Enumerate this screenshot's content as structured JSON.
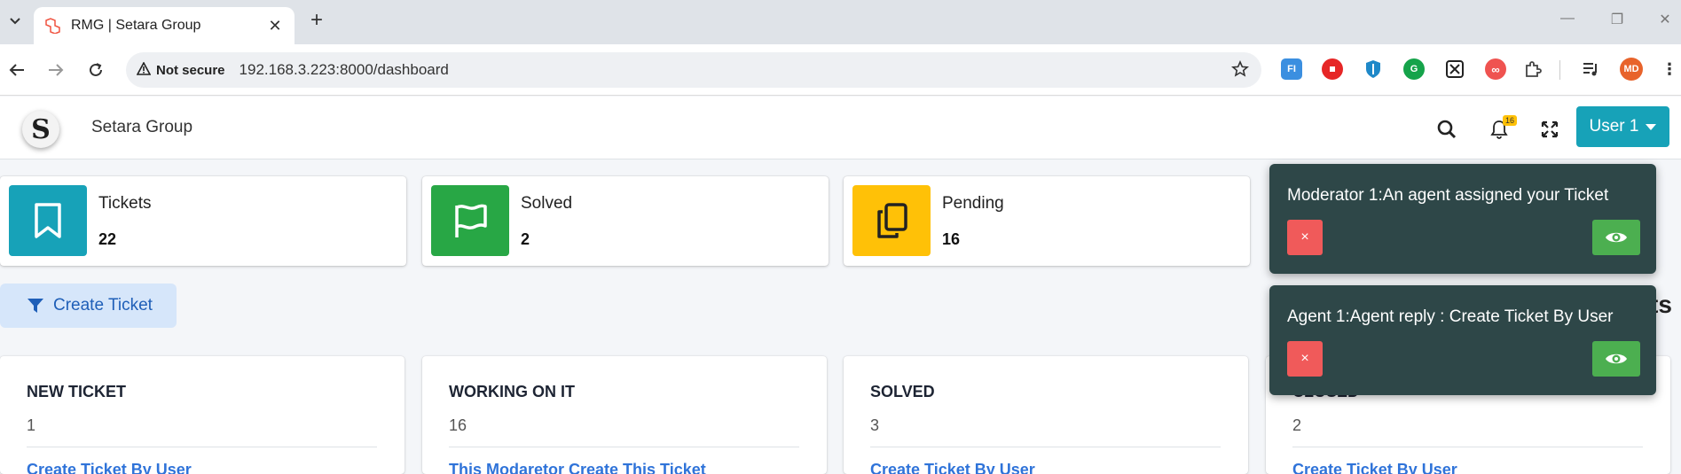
{
  "browser": {
    "tab_title": "RMG | Setara Group",
    "not_secure_label": "Not secure",
    "url": "192.168.3.223:8000/dashboard",
    "extensions": [
      {
        "name": "FI",
        "color": "#3b8fe0"
      },
      {
        "name": "",
        "color": "#e62626"
      },
      {
        "name": "",
        "color": "#1e88c8"
      },
      {
        "name": "",
        "color": "#15a34a"
      },
      {
        "name": "",
        "color": "#222222"
      },
      {
        "name": "",
        "color": "#ef5350"
      },
      {
        "name": "",
        "color": "#444444"
      }
    ],
    "profile_initials": "MD"
  },
  "app": {
    "brand_name": "Setara Group",
    "logo_letter": "S",
    "notification_count": "16",
    "user_menu_label": "User 1"
  },
  "stats": [
    {
      "label": "Tickets",
      "value": "22",
      "color": "#17a2b8",
      "icon": "bookmark-icon"
    },
    {
      "label": "Solved",
      "value": "2",
      "color": "#28a745",
      "icon": "flag-icon"
    },
    {
      "label": "Pending",
      "value": "16",
      "color": "#ffc107",
      "icon": "copy-icon"
    }
  ],
  "actions": {
    "create_ticket_label": "Create Ticket",
    "peek_text": "ts"
  },
  "columns": [
    {
      "title": "NEW TICKET",
      "count": "1",
      "first_item": "Create Ticket By User"
    },
    {
      "title": "WORKING ON IT",
      "count": "16",
      "first_item": "This Modaretor Create This Ticket"
    },
    {
      "title": "SOLVED",
      "count": "3",
      "first_item": "Create Ticket By User"
    },
    {
      "title": "CLOSED",
      "count": "2",
      "first_item": "Create Ticket By User"
    }
  ],
  "toasts": [
    {
      "message": "Moderator 1:An agent assigned your Ticket",
      "close_label": "×"
    },
    {
      "message": "Agent 1:Agent reply : Create Ticket By User",
      "close_label": "×"
    }
  ]
}
